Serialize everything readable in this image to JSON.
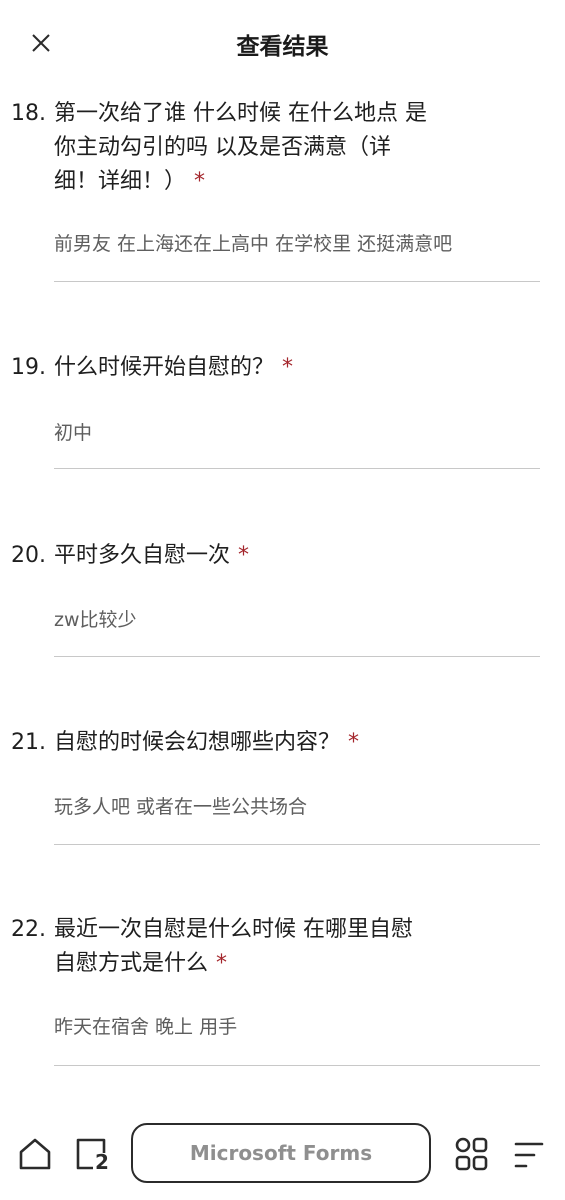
{
  "header": {
    "title": "查看结果"
  },
  "questions": [
    {
      "number": "18.",
      "text": "第一次给了谁 什么时候 在什么地点 是\n你主动勾引的吗 以及是否满意（详\n细！详细！）",
      "required": "*",
      "answer": "前男友 在上海还在上高中 在学校里 还挺满意吧"
    },
    {
      "number": "19.",
      "text": "什么时候开始自慰的？",
      "required": "*",
      "answer": "初中"
    },
    {
      "number": "20.",
      "text": "平时多久自慰一次",
      "required": "*",
      "answer": "zw比较少"
    },
    {
      "number": "21.",
      "text": "自慰的时候会幻想哪些内容？",
      "required": "*",
      "answer": "玩多人吧 或者在一些公共场合"
    },
    {
      "number": "22.",
      "text": "最近一次自慰是什么时候 在哪里自慰\n自慰方式是什么",
      "required": "*",
      "answer": "昨天在宿舍 晚上 用手"
    }
  ],
  "bottom_bar": {
    "url_label": "Microsoft Forms",
    "tab_count": "2",
    "icons": [
      "home-icon",
      "tabs-icon",
      "apps-grid-icon",
      "menu-icon"
    ]
  },
  "colors": {
    "required": "#a4262c",
    "answer": "#5e5e5e",
    "divider": "#c8c8c8"
  }
}
